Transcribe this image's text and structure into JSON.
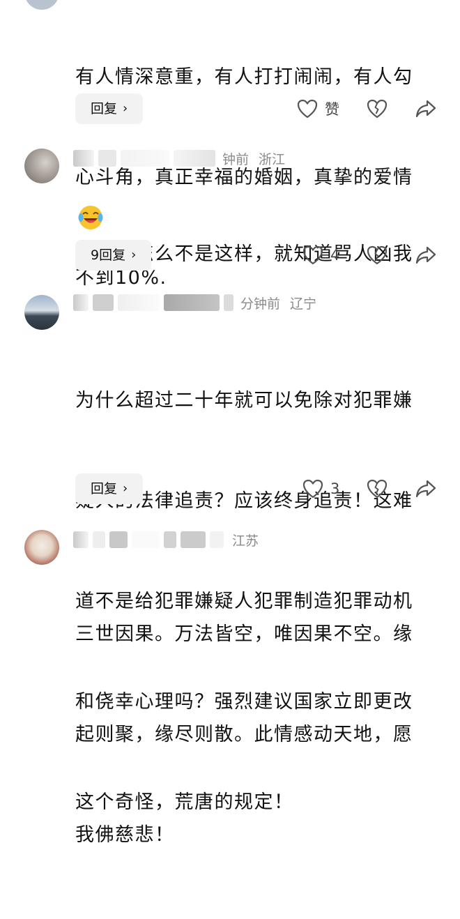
{
  "comments": [
    {
      "lines": [
        "有人情深意重，有人打打闹闹，有人勾",
        "心斗角，真正幸福的婚姻，真挚的爱情",
        "不到10%."
      ],
      "meta_time": "",
      "meta_location": "",
      "reply_label": "回复",
      "like_label": "赞",
      "like_count": ""
    },
    {
      "lines": [
        "我老公怎么不是这样，就知道骂人凶我"
      ],
      "meta_time": "钟前",
      "meta_location": "浙江",
      "emoji": "crying-laughing-emoji",
      "reply_label": "9回复",
      "like_count": "4"
    },
    {
      "lines": [
        "为什么超过二十年就可以免除对犯罪嫌",
        "疑人的法律追责？应该终身追责！这难",
        "道不是给犯罪嫌疑人犯罪制造犯罪动机",
        "和侥幸心理吗？强烈建议国家立即更改",
        "这个奇怪，荒唐的规定！"
      ],
      "meta_time": "分钟前",
      "meta_location": "辽宁",
      "reply_label": "回复",
      "like_count": "3"
    },
    {
      "lines": [
        "三世因果。万法皆空，唯因果不空。缘",
        "起则聚，缘尽则散。此情感动天地，愿",
        "我佛慈悲！"
      ],
      "meta_time": "",
      "meta_location": "江苏"
    }
  ],
  "icons": {
    "like": "heart-outline-icon",
    "dislike": "broken-heart-icon",
    "share": "share-arrow-icon",
    "chevron": "chevron-right-icon"
  },
  "chevron_glyph": "›"
}
